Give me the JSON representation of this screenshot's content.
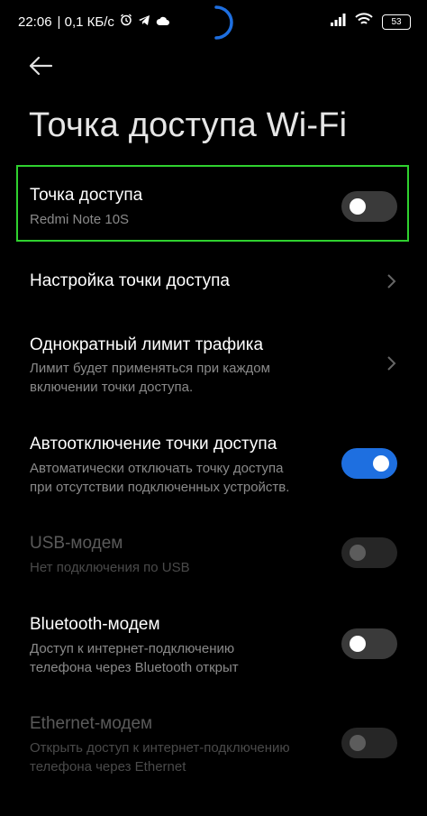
{
  "status_bar": {
    "time": "22:06",
    "network_speed": "| 0,1 КБ/с",
    "battery": "53",
    "icons": [
      "alarm-icon",
      "telegram-icon",
      "cloud-icon",
      "signal-icon",
      "wifi-icon",
      "battery-icon"
    ]
  },
  "header": {
    "title": "Точка доступа Wi-Fi"
  },
  "settings": {
    "hotspot": {
      "title": "Точка доступа",
      "subtitle": "Redmi Note 10S",
      "enabled": false
    },
    "hotspot_setup": {
      "title": "Настройка точки доступа"
    },
    "traffic_limit": {
      "title": "Однократный лимит трафика",
      "subtitle_1": "Лимит будет применяться при каждом",
      "subtitle_2": "включении точки доступа."
    },
    "auto_off": {
      "title": "Автоотключение точки доступа",
      "subtitle_1": "Автоматически отключать точку доступа",
      "subtitle_2": "при отсутствии подключенных устройств.",
      "enabled": true
    },
    "usb_modem": {
      "title": "USB-модем",
      "subtitle": "Нет подключения по USB",
      "enabled": false,
      "disabled": true
    },
    "bluetooth_modem": {
      "title": "Bluetooth-модем",
      "subtitle_1": "Доступ к интернет-подключению",
      "subtitle_2": "телефона через Bluetooth открыт",
      "enabled": false
    },
    "ethernet_modem": {
      "title": "Ethernet-модем",
      "subtitle_1": "Открыть доступ к интернет-подключению",
      "subtitle_2": "телефона через Ethernet",
      "enabled": false,
      "disabled": true
    }
  },
  "colors": {
    "accent": "#1e6fe0",
    "highlight": "#2fd12f",
    "background": "#000000"
  }
}
